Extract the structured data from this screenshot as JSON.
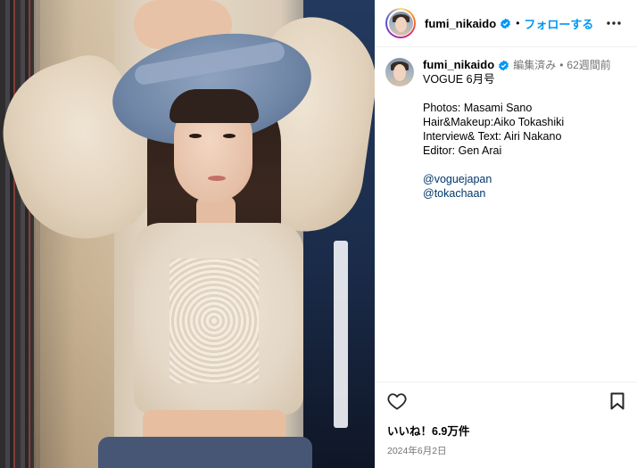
{
  "header": {
    "username": "fumi_nikaido",
    "separator": "•",
    "follow_label": "フォローする",
    "more_icon": "more-horizontal-icon"
  },
  "caption": {
    "username": "fumi_nikaido",
    "edited": "編集済み",
    "time_ago": "62週間前",
    "separator": "•",
    "lines": [
      "VOGUE 6月号",
      "",
      "Photos: Masami Sano",
      "Hair&Makeup:Aiko Tokashiki",
      "Interview& Text: Airi Nakano",
      "Editor: Gen Arai",
      ""
    ],
    "mentions": [
      "@voguejapan",
      "@tokachaan"
    ]
  },
  "footer": {
    "like_icon": "heart-icon",
    "save_icon": "bookmark-icon",
    "likes": "いいね！6.9万件",
    "date": "2024年6月2日"
  },
  "colors": {
    "accent_blue": "#0095f6",
    "mention_blue": "#00376b",
    "meta_gray": "#737373",
    "verified_blue": "#0095f6"
  }
}
